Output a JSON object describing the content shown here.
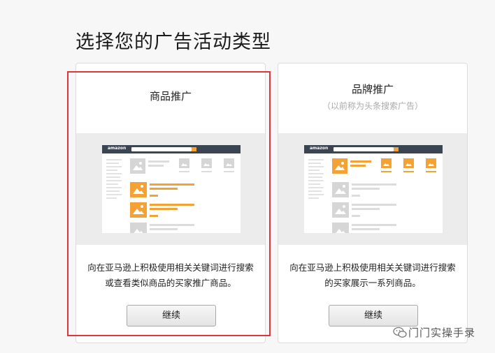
{
  "page_title": "选择您的广告活动类型",
  "cards": [
    {
      "title": "商品推广",
      "subtitle": "",
      "description": "向在亚马逊上积极使用相关关键词进行搜索或查看类似商品的买家推广商品。",
      "button_label": "继续",
      "selected": true,
      "preview_logo": "amazon"
    },
    {
      "title": "品牌推广",
      "subtitle": "（以前称为头条搜索广告）",
      "description": "向在亚马逊上积极使用相关关键词进行搜索的买家展示一系列商品。",
      "button_label": "继续",
      "selected": false,
      "preview_logo": "amazon"
    }
  ],
  "watermark": {
    "text": "门门实操手录",
    "icon": "wechat-icon"
  },
  "colors": {
    "selection_outline": "#e0353c",
    "accent_orange": "#f4a235",
    "preview_topbar": "#3b4552"
  }
}
